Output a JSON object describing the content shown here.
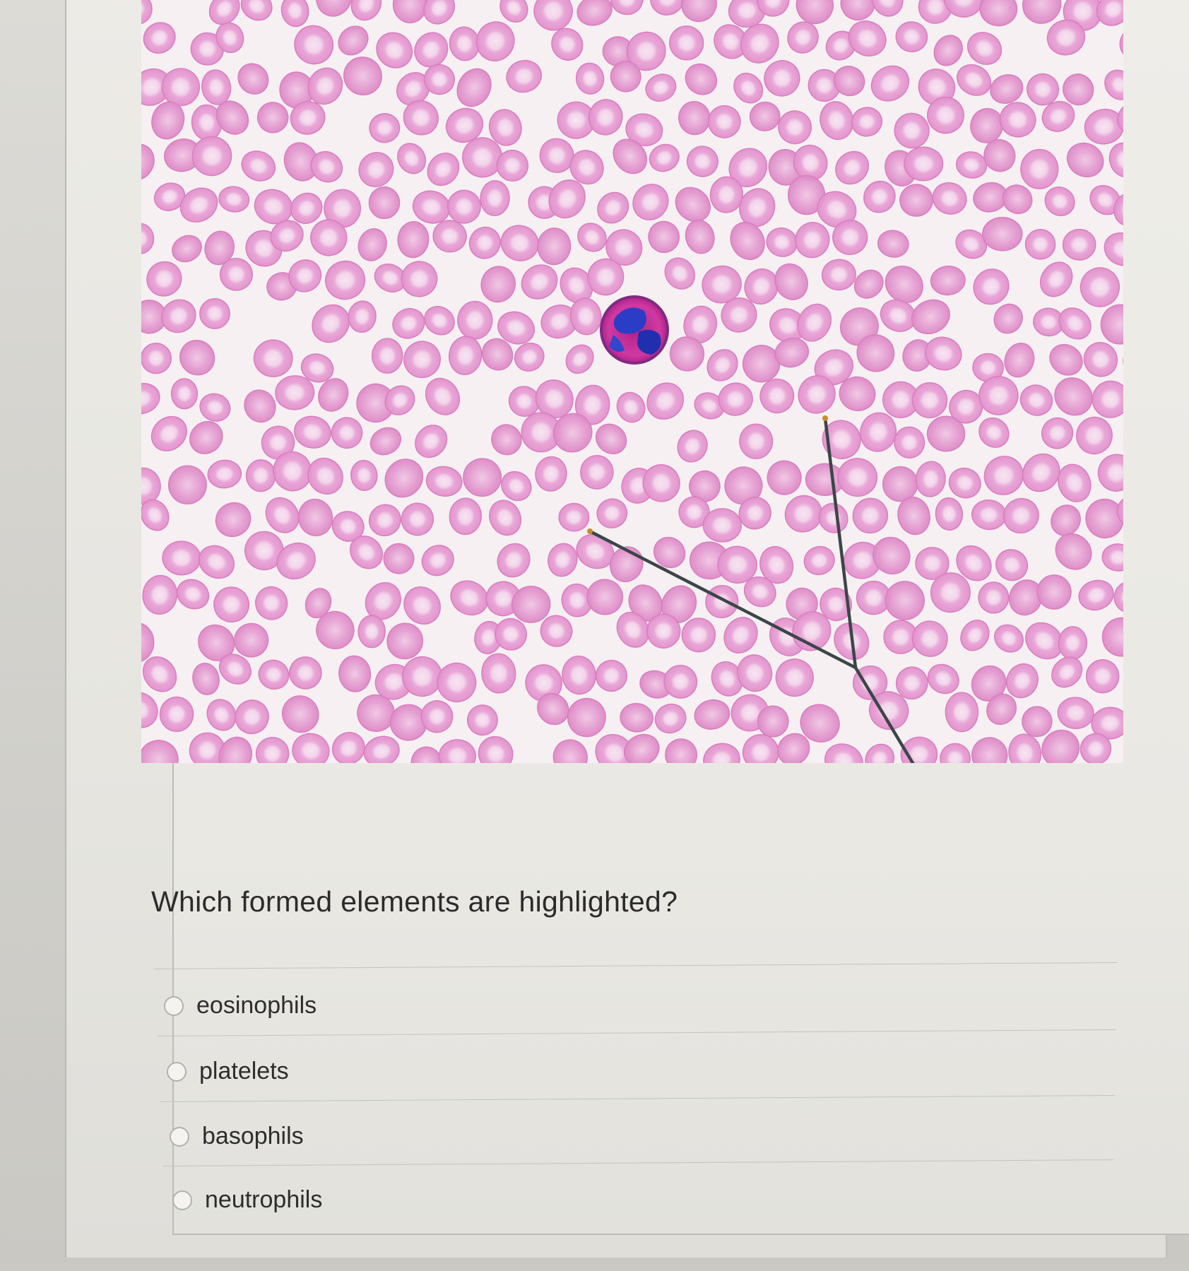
{
  "question": {
    "prompt": "Which formed elements are highlighted?",
    "options": [
      {
        "label": "eosinophils",
        "selected": false
      },
      {
        "label": "platelets",
        "selected": false
      },
      {
        "label": "basophils",
        "selected": false
      },
      {
        "label": "neutrophils",
        "selected": false
      }
    ]
  },
  "image": {
    "content": "blood smear micrograph",
    "colors": {
      "rbc_fill": "#e59ad0",
      "rbc_center": "#f6dff0",
      "background": "#f6f0f2",
      "nucleus": "#2a3fc4",
      "granule_cytoplasm": "#c8309a",
      "pointer": "#3b4648"
    }
  }
}
